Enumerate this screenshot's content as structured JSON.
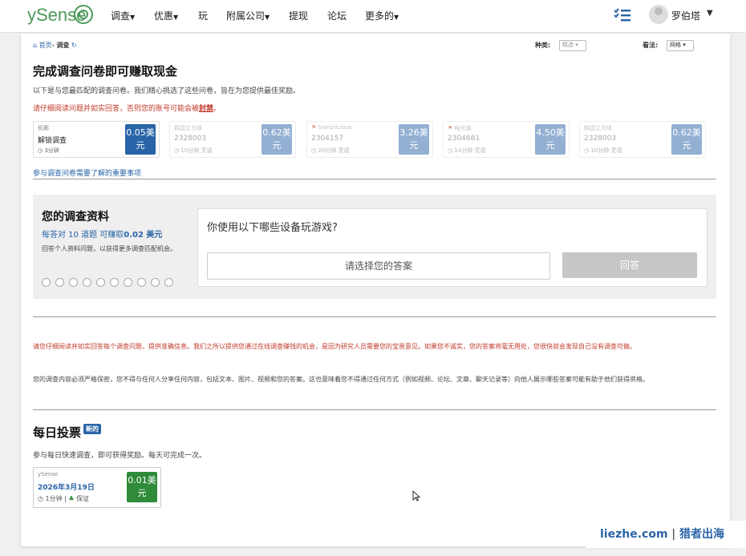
{
  "nav": {
    "logo": "ySense",
    "items": [
      "调查",
      "优惠",
      "玩",
      "附属公司",
      "提现",
      "论坛",
      "更多的"
    ],
    "user_name": "罗伯塔"
  },
  "breadcrumb": {
    "home": "首页",
    "separator": "›",
    "current": "调查"
  },
  "filters": {
    "type_label": "种类:",
    "type_value": "精选",
    "view_label": "看法:",
    "view_value": "网格"
  },
  "header": {
    "title": "完成调查问卷即可赚取现金",
    "subtitle": "以下是与您最匹配的调查问卷。我们精心挑选了这些问卷，旨在为您提供最佳奖励。",
    "warning_prefix": "请仔细阅读问题并如实回答，否则您的账号可能会被",
    "warning_strong": "封禁",
    "warning_suffix": "。"
  },
  "survey_cards": [
    {
      "source": "轮廓",
      "title": "解锁调查",
      "meta": "3分钟",
      "price": "0.05美元",
      "color": "#2a64a8"
    },
    {
      "source": "韩国立方体",
      "title": "2328003",
      "meta": "10分钟  灵话",
      "price": "0.62美元",
      "color": "#2a64a8"
    },
    {
      "source": "Samplicious",
      "title": "2304157",
      "meta": "20分钟  灵话",
      "price": "3.26美元",
      "color": "#2a64a8"
    },
    {
      "source": "纯光谱",
      "title": "2304681",
      "meta": "14分钟  灵话",
      "price": "4.50美元",
      "color": "#2a64a8"
    },
    {
      "source": "韩国立方体",
      "title": "2328003",
      "meta": "10分钟  灵话",
      "price": "0.62美元",
      "color": "#2a64a8"
    }
  ],
  "important_link": "参与调查问卷需要了解的重要事项",
  "profile": {
    "title": "您的调查资料",
    "rate": "每答对 10 道题 可赚取",
    "rate_strong": "0.02 美元",
    "desc": "回答个人资料问题，以获得更多调查匹配机会。",
    "question": "你使用以下哪些设备玩游戏?",
    "answer_placeholder": "请选择您的答案",
    "answer_button": "回答"
  },
  "notices": {
    "red": "请您仔细阅读并如实回答每个调查问题，提供准确信息。我们之所以提供您通过在线调查赚钱的机会，是因为研究人员需要您的宝贵意见。如果您不诚实，您的答案将毫无用处，您很快就会发现自己没有调查可做。",
    "grey": "您的调查内容必须严格保密，您不得与任何人分享任何内容，包括文本、图片、视频和您的答案。这也意味着您不得通过任何方式（例如视频、论坛、文章、聊天记录等）向他人展示哪些答案可能有助于他们获得资格。"
  },
  "daily_poll": {
    "title": "每日投票",
    "badge": "新的",
    "desc": "参与每日快速调查，即可获得奖励。每天可完成一次。",
    "card_source": "ySense",
    "card_date": "2026年3月19日",
    "card_time": "1分钟",
    "card_guarantee": "保证",
    "card_price": "0.01美元"
  },
  "watermark": {
    "site": "liezhe.com",
    "separator": "|",
    "name": "猎者出海"
  }
}
